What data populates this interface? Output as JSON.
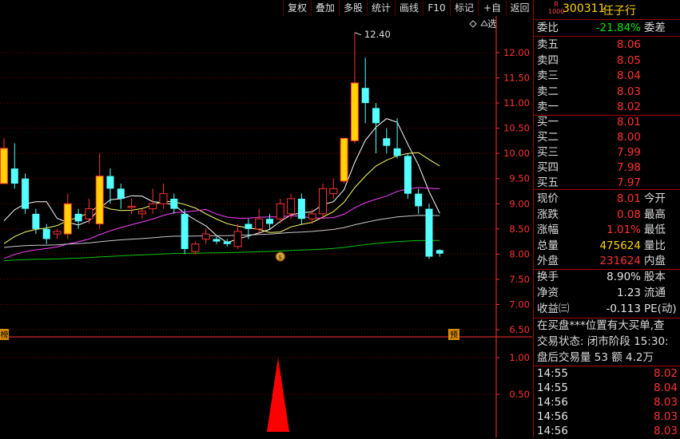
{
  "toolbar": {
    "buttons": [
      "复权",
      "叠加",
      "多股",
      "统计",
      "画线",
      "F10",
      "标记",
      "+自选",
      "返回"
    ]
  },
  "chart_data": {
    "type": "candlestick",
    "y_ticks": [
      "12.00",
      "11.50",
      "11.00",
      "10.50",
      "10.00",
      "9.50",
      "9.00",
      "8.50",
      "8.00",
      "7.50",
      "7.00",
      "6.50"
    ],
    "high_label": "12.40",
    "left_badge": "榜",
    "right_badge": "预",
    "sub_ticks": [
      "1.00",
      "0.50"
    ],
    "colors": {
      "up": "#ffd200",
      "down": "#54ffff",
      "ma5": "#ffffff",
      "ma10": "#ffff66",
      "ma20": "#ff40ff",
      "ma60": "#c8c8c8",
      "ma120": "#00c800",
      "grid": "#8b0000",
      "axis": "#ff3232"
    },
    "candles": [
      {
        "o": 9.4,
        "c": 10.1,
        "h": 10.3,
        "l": 9.4
      },
      {
        "o": 9.7,
        "c": 9.4,
        "h": 10.2,
        "l": 9.3
      },
      {
        "o": 9.5,
        "c": 8.9,
        "h": 9.6,
        "l": 8.8
      },
      {
        "o": 8.8,
        "c": 8.5,
        "h": 8.9,
        "l": 8.4
      },
      {
        "o": 8.5,
        "c": 8.3,
        "h": 8.6,
        "l": 8.2
      },
      {
        "o": 8.4,
        "c": 8.45,
        "h": 8.5,
        "l": 8.3
      },
      {
        "o": 8.4,
        "c": 9.0,
        "h": 9.2,
        "l": 8.3
      },
      {
        "o": 8.8,
        "c": 8.65,
        "h": 8.9,
        "l": 8.5
      },
      {
        "o": 8.7,
        "c": 8.9,
        "h": 9.1,
        "l": 8.6
      },
      {
        "o": 8.6,
        "c": 9.55,
        "h": 10.0,
        "l": 8.5
      },
      {
        "o": 9.55,
        "c": 9.3,
        "h": 9.7,
        "l": 9.0
      },
      {
        "o": 9.3,
        "c": 9.1,
        "h": 9.4,
        "l": 8.9
      },
      {
        "o": 8.95,
        "c": 8.95,
        "h": 9.1,
        "l": 8.8
      },
      {
        "o": 8.8,
        "c": 8.85,
        "h": 8.9,
        "l": 8.7
      },
      {
        "o": 8.9,
        "c": 9.0,
        "h": 9.3,
        "l": 8.8
      },
      {
        "o": 9.0,
        "c": 9.2,
        "h": 9.4,
        "l": 8.9
      },
      {
        "o": 9.1,
        "c": 8.9,
        "h": 9.2,
        "l": 8.8
      },
      {
        "o": 8.8,
        "c": 8.1,
        "h": 8.9,
        "l": 8.0
      },
      {
        "o": 8.05,
        "c": 8.2,
        "h": 8.25,
        "l": 8.0
      },
      {
        "o": 8.3,
        "c": 8.4,
        "h": 8.5,
        "l": 8.2
      },
      {
        "o": 8.3,
        "c": 8.25,
        "h": 8.35,
        "l": 8.2
      },
      {
        "o": 8.25,
        "c": 8.2,
        "h": 8.3,
        "l": 8.15
      },
      {
        "o": 8.15,
        "c": 8.45,
        "h": 8.6,
        "l": 8.1
      },
      {
        "o": 8.6,
        "c": 8.5,
        "h": 8.7,
        "l": 8.3
      },
      {
        "o": 8.5,
        "c": 8.7,
        "h": 8.9,
        "l": 8.4
      },
      {
        "o": 8.7,
        "c": 8.6,
        "h": 8.8,
        "l": 8.5
      },
      {
        "o": 8.7,
        "c": 9.0,
        "h": 9.1,
        "l": 8.6
      },
      {
        "o": 8.8,
        "c": 9.1,
        "h": 9.2,
        "l": 8.7
      },
      {
        "o": 9.1,
        "c": 8.7,
        "h": 9.2,
        "l": 8.6
      },
      {
        "o": 8.7,
        "c": 8.8,
        "h": 8.9,
        "l": 8.6
      },
      {
        "o": 8.8,
        "c": 9.3,
        "h": 9.4,
        "l": 8.7
      },
      {
        "o": 9.2,
        "c": 9.3,
        "h": 9.5,
        "l": 9.1
      },
      {
        "o": 9.45,
        "c": 10.3,
        "h": 10.3,
        "l": 9.4
      },
      {
        "o": 10.25,
        "c": 11.4,
        "h": 12.4,
        "l": 10.2
      },
      {
        "o": 11.3,
        "c": 11.0,
        "h": 11.9,
        "l": 10.6
      },
      {
        "o": 10.9,
        "c": 10.6,
        "h": 11.0,
        "l": 10.0
      },
      {
        "o": 10.3,
        "c": 10.15,
        "h": 10.5,
        "l": 10.0
      },
      {
        "o": 10.1,
        "c": 9.95,
        "h": 10.7,
        "l": 9.9
      },
      {
        "o": 9.95,
        "c": 9.2,
        "h": 10.0,
        "l": 9.1
      },
      {
        "o": 9.2,
        "c": 8.95,
        "h": 9.3,
        "l": 8.8
      },
      {
        "o": 8.9,
        "c": 7.95,
        "h": 9.0,
        "l": 7.9
      },
      {
        "o": 8.08,
        "c": 8.01,
        "h": 8.1,
        "l": 7.95
      }
    ]
  },
  "panel": {
    "logo_top": "R",
    "logo_bottom": "1000",
    "code": "300311",
    "name": "任子行",
    "webi_label": "委比",
    "webi_value": "-21.84%",
    "wecha_label": "委差",
    "sell": [
      {
        "label": "卖五",
        "price": "8.06"
      },
      {
        "label": "卖四",
        "price": "8.05"
      },
      {
        "label": "卖三",
        "price": "8.04"
      },
      {
        "label": "卖二",
        "price": "8.03"
      },
      {
        "label": "卖一",
        "price": "8.02"
      }
    ],
    "buy": [
      {
        "label": "买一",
        "price": "8.01"
      },
      {
        "label": "买二",
        "price": "8.00"
      },
      {
        "label": "买三",
        "price": "7.99"
      },
      {
        "label": "买四",
        "price": "7.98"
      },
      {
        "label": "买五",
        "price": "7.97"
      }
    ],
    "quotes": [
      {
        "label": "现价",
        "value": "8.01",
        "label2": "今开",
        "color": "red"
      },
      {
        "label": "涨跌",
        "value": "0.08",
        "label2": "最高",
        "color": "red"
      },
      {
        "label": "涨幅",
        "value": "1.01%",
        "label2": "最低",
        "color": "red"
      },
      {
        "label": "总量",
        "value": "475624",
        "label2": "量比",
        "color": "yellow"
      },
      {
        "label": "外盘",
        "value": "231624",
        "label2": "内盘",
        "color": "red"
      }
    ],
    "stats": [
      {
        "label": "换手",
        "value": "8.90%",
        "label2": "股本"
      },
      {
        "label": "净资",
        "value": "1.23",
        "label2": "流通"
      },
      {
        "label": "收益㈢",
        "value": "-0.113",
        "label2": "PE(动)"
      }
    ],
    "info": [
      "在买盘***位置有大买单,查",
      "交易状态: 闭市阶段 15:30:",
      "盘后交易量 53 额 4.2万"
    ],
    "ticks": [
      {
        "time": "14:55",
        "price": "8.02"
      },
      {
        "time": "14:55",
        "price": "8.04"
      },
      {
        "time": "14:56",
        "price": "8.03"
      },
      {
        "time": "14:56",
        "price": "8.03"
      },
      {
        "time": "14:56",
        "price": "8.03"
      }
    ]
  }
}
